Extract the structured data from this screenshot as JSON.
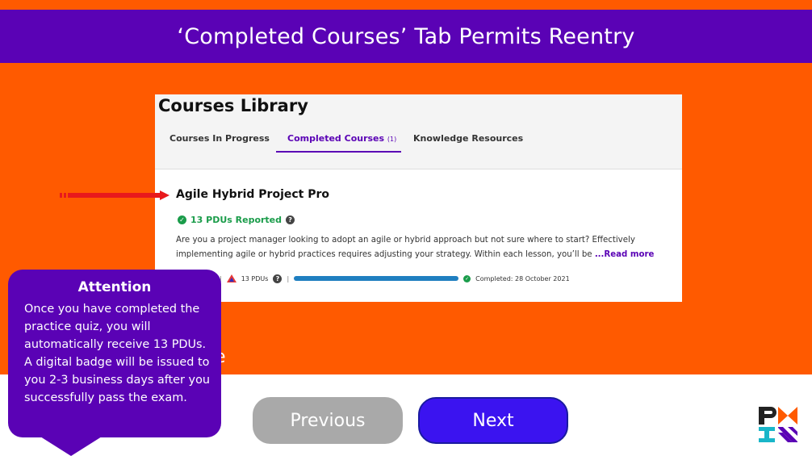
{
  "slide": {
    "title": "‘Completed Courses’ Tab Permits Reentry"
  },
  "library": {
    "title": "Courses Library",
    "tabs": [
      {
        "label": "Courses In Progress",
        "count": ""
      },
      {
        "label": "Completed Courses",
        "count": "(1)"
      },
      {
        "label": "Knowledge Resources",
        "count": ""
      }
    ],
    "selected_tab": "Completed Courses",
    "course": {
      "title": "Agile Hybrid Project Pro",
      "pdus_reported": "13 PDUs Reported",
      "description": "Are you a project manager looking to adopt an agile or hybrid approach but not sure where to start? Effectively implementing agile or hybrid practices requires adjusting your strategy. Within each lesson, you’ll be",
      "read_more": "...Read more",
      "pdus": "13 PDUs",
      "progress": 1.0,
      "completed": "Completed: 28 October 2021"
    }
  },
  "callout": {
    "heading": "Attention",
    "body": "Once you have completed the practice quiz, you will automatically receive 13 PDUs. A digital badge will be issued to you 2-3 business days after you successfully pass the exam.",
    "peek_char": "e"
  },
  "nav": {
    "previous": "Previous",
    "next": "Next"
  },
  "colors": {
    "brand_purple": "#5a02b5",
    "brand_orange": "#ff5a00",
    "next_blue": "#3b13f0",
    "success_green": "#1a9c4a",
    "arrow_red": "#e8191c"
  }
}
